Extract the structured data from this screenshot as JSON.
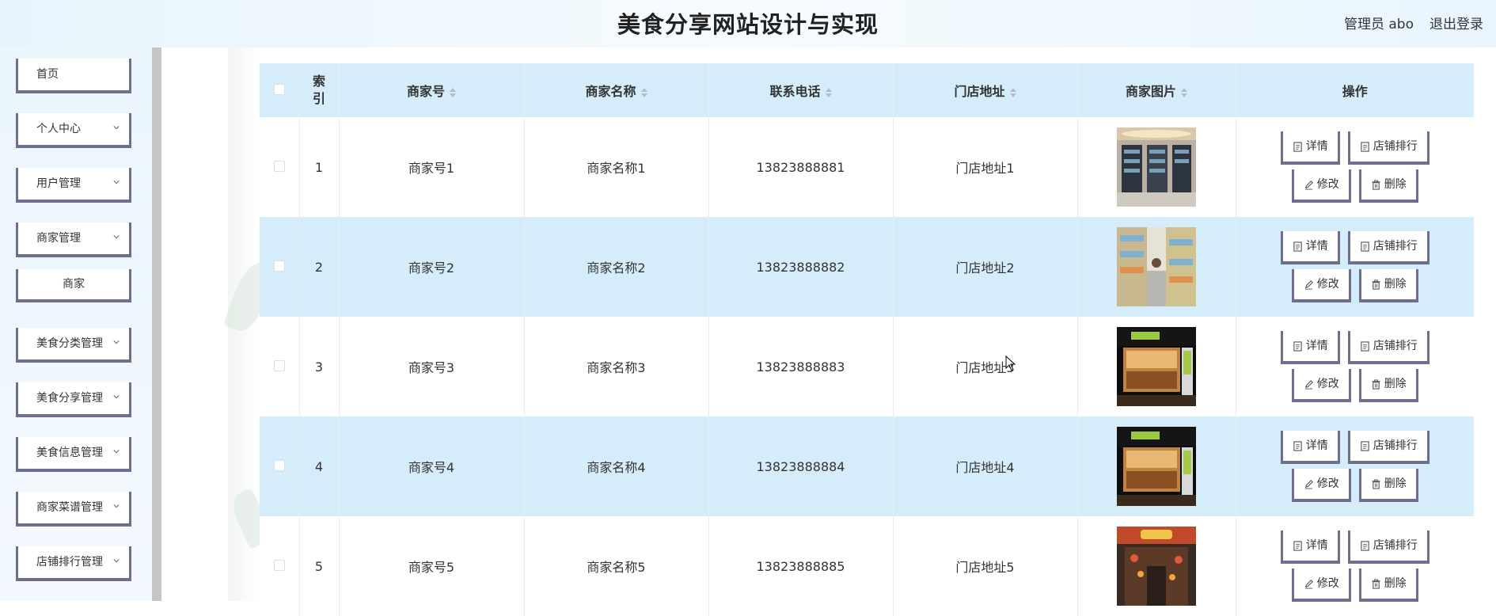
{
  "header": {
    "title": "美食分享网站设计与实现",
    "user_label": "管理员 abo",
    "logout_label": "退出登录"
  },
  "sidebar": {
    "items": [
      {
        "label": "首页",
        "has_chevron": false
      },
      {
        "label": "个人中心",
        "has_chevron": true
      },
      {
        "label": "用户管理",
        "has_chevron": true
      },
      {
        "label": "商家管理",
        "has_chevron": true
      },
      {
        "label": "商家",
        "has_chevron": false,
        "submenu": true
      },
      {
        "label": "美食分类管理",
        "has_chevron": true
      },
      {
        "label": "美食分享管理",
        "has_chevron": true
      },
      {
        "label": "美食信息管理",
        "has_chevron": true
      },
      {
        "label": "商家菜谱管理",
        "has_chevron": true
      },
      {
        "label": "店铺排行管理",
        "has_chevron": true
      }
    ]
  },
  "table": {
    "columns": {
      "index": "索引",
      "merchant_no": "商家号",
      "merchant_name": "商家名称",
      "phone": "联系电话",
      "address": "门店地址",
      "image": "商家图片",
      "ops": "操作"
    },
    "actions": {
      "detail": "详情",
      "ranking": "店铺排行",
      "edit": "修改",
      "delete": "删除"
    },
    "rows": [
      {
        "index": "1",
        "merchant_no": "商家号1",
        "merchant_name": "商家名称1",
        "phone": "13823888881",
        "address": "门店地址1",
        "image_icon": "store-shelves-photo"
      },
      {
        "index": "2",
        "merchant_no": "商家号2",
        "merchant_name": "商家名称2",
        "phone": "13823888882",
        "address": "门店地址2",
        "image_icon": "supermarket-aisle-photo"
      },
      {
        "index": "3",
        "merchant_no": "商家号3",
        "merchant_name": "商家名称3",
        "phone": "13823888883",
        "address": "门店地址3",
        "image_icon": "shop-front-photo"
      },
      {
        "index": "4",
        "merchant_no": "商家号4",
        "merchant_name": "商家名称4",
        "phone": "13823888884",
        "address": "门店地址4",
        "image_icon": "shop-front-photo"
      },
      {
        "index": "5",
        "merchant_no": "商家号5",
        "merchant_name": "商家名称5",
        "phone": "13823888885",
        "address": "门店地址5",
        "image_icon": "market-entrance-photo"
      }
    ]
  },
  "colors": {
    "header_bg": "#e8f4fc",
    "row_highlight": "#d5edfa",
    "button_border": "#6f6e8f",
    "scrollbar": "#c6c6c6"
  }
}
